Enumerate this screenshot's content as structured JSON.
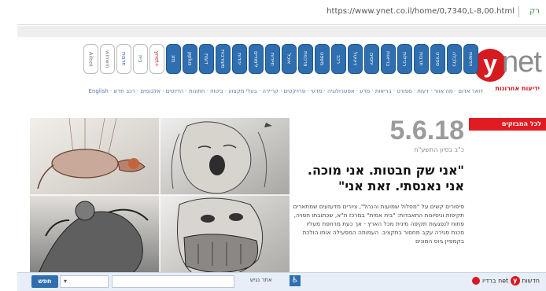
{
  "browser": {
    "url": "https://www.ynet.co.il/home/0,7340,L-8,00.html",
    "extra": "רק"
  },
  "header": {
    "logo_letter": "y",
    "logo_text": "net",
    "logo_tagline": "ידיעות אחרונות",
    "tabs": [
      "חדשות",
      "כלכלה",
      "ספורט",
      "תרבות",
      "רכילות",
      "בריאות",
      "יחסים",
      "דיגיטל",
      "רכב",
      "משפט",
      "צרכנות",
      "אוכל",
      "תיירות",
      "לימודים",
      "יהדות",
      "מעורבות",
      "דעות",
      "pplus",
      "מזג",
      "ynet+",
      "בית",
      "תרבות",
      "winwin",
      "Ailbot"
    ],
    "tab_icons": [
      "ynet",
      "tab",
      "tab",
      "tab",
      "tab",
      "tab",
      "tab",
      "tab",
      "tab",
      "tab",
      "tab",
      "tab",
      "tab",
      "tab",
      "tab",
      "tab",
      "tab",
      "tab",
      "tab",
      "hot",
      "yes",
      "orange",
      "winwin",
      "ailbot"
    ],
    "subnav": "דואר אדום · מה אוור · דעות · ספורט · בריאות · מדע · אסטרולוגיה · מדעי · פרויקטים · קריירה · בעלי מקצוע · ביטוח · חתונות · הדיוטים · אלבומים · רכב חדש · English"
  },
  "sidebar": {
    "red_label": "לכל המבזקים"
  },
  "article": {
    "date": "5.6.18",
    "hebrew_date": "כ\"ב בסיון התשע\"ח",
    "headline": "\"אני שק חבטות. אני מוכה. אני נאנסתי. זאת אני\"",
    "body": "סיפורים קשים על \"מסלול שמועות והנהל\", ציורים מדעזעים שמתארים תקיפות וניסיונות התאבדות: \"בית אמית\" במרכז ת\"א, שכתובתו חסויה, פתוח לנפגעות תקיפה מינית מכל הארץ - אך כעת מרחפת מעליו סכנת סגירה עקב מחסור בתקציב. העמותה המפעילה אותו הולכת בקמפיין גיוס המונים"
  },
  "footer": {
    "search_label": "חפש",
    "search_select": "",
    "accessibility_label": "אתר נגיש",
    "news_brand_label": "חדשות",
    "news_brand_y": "y",
    "news_brand_net": "net",
    "news_brand_suffix": "ברדיו"
  },
  "colors": {
    "brand_red": "#d71920",
    "tab_blue": "#2f6fb0",
    "date_gray": "#9b9b9b"
  }
}
